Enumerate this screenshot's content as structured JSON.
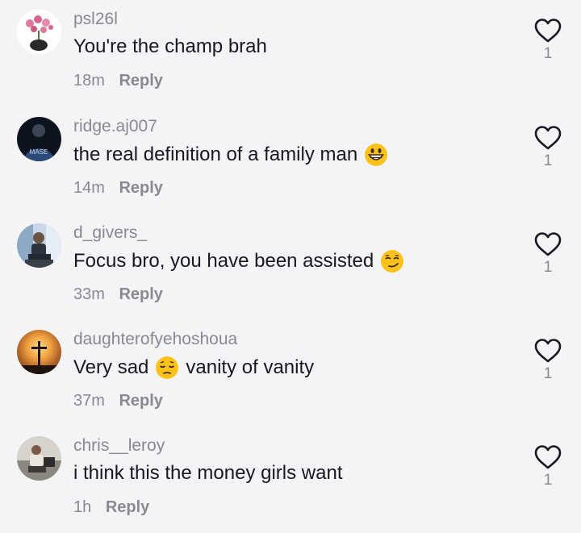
{
  "comments": [
    {
      "username": "psl26l",
      "text": "You're the champ brah",
      "emoji": "",
      "text_after": "",
      "time": "18m",
      "reply": "Reply",
      "likes": "1",
      "avatar": "flower-pot-avatar"
    },
    {
      "username": "ridge.aj007",
      "text": "the real definition of a family man",
      "emoji": "grinning-face-emoji",
      "text_after": "",
      "time": "14m",
      "reply": "Reply",
      "likes": "1",
      "avatar": "person-dark-avatar"
    },
    {
      "username": "d_givers_",
      "text": "Focus bro, you have been assisted",
      "emoji": "smirking-face-emoji",
      "text_after": "",
      "time": "33m",
      "reply": "Reply",
      "likes": "1",
      "avatar": "person-sitting-avatar"
    },
    {
      "username": "daughterofyehoshoua",
      "text": "Very sad",
      "emoji": "pensive-face-emoji",
      "text_after": "vanity of vanity",
      "time": "37m",
      "reply": "Reply",
      "likes": "1",
      "avatar": "cross-sunset-avatar"
    },
    {
      "username": "chris__leroy",
      "text": "i think this the money girls want",
      "emoji": "",
      "text_after": "",
      "time": "1h",
      "reply": "Reply",
      "likes": "1",
      "avatar": "person-car-avatar"
    }
  ],
  "icons": {
    "like": "heart-outline-icon"
  },
  "colors": {
    "background": "#f4f4f6",
    "text": "#161823",
    "secondary": "#8a8a8e"
  }
}
